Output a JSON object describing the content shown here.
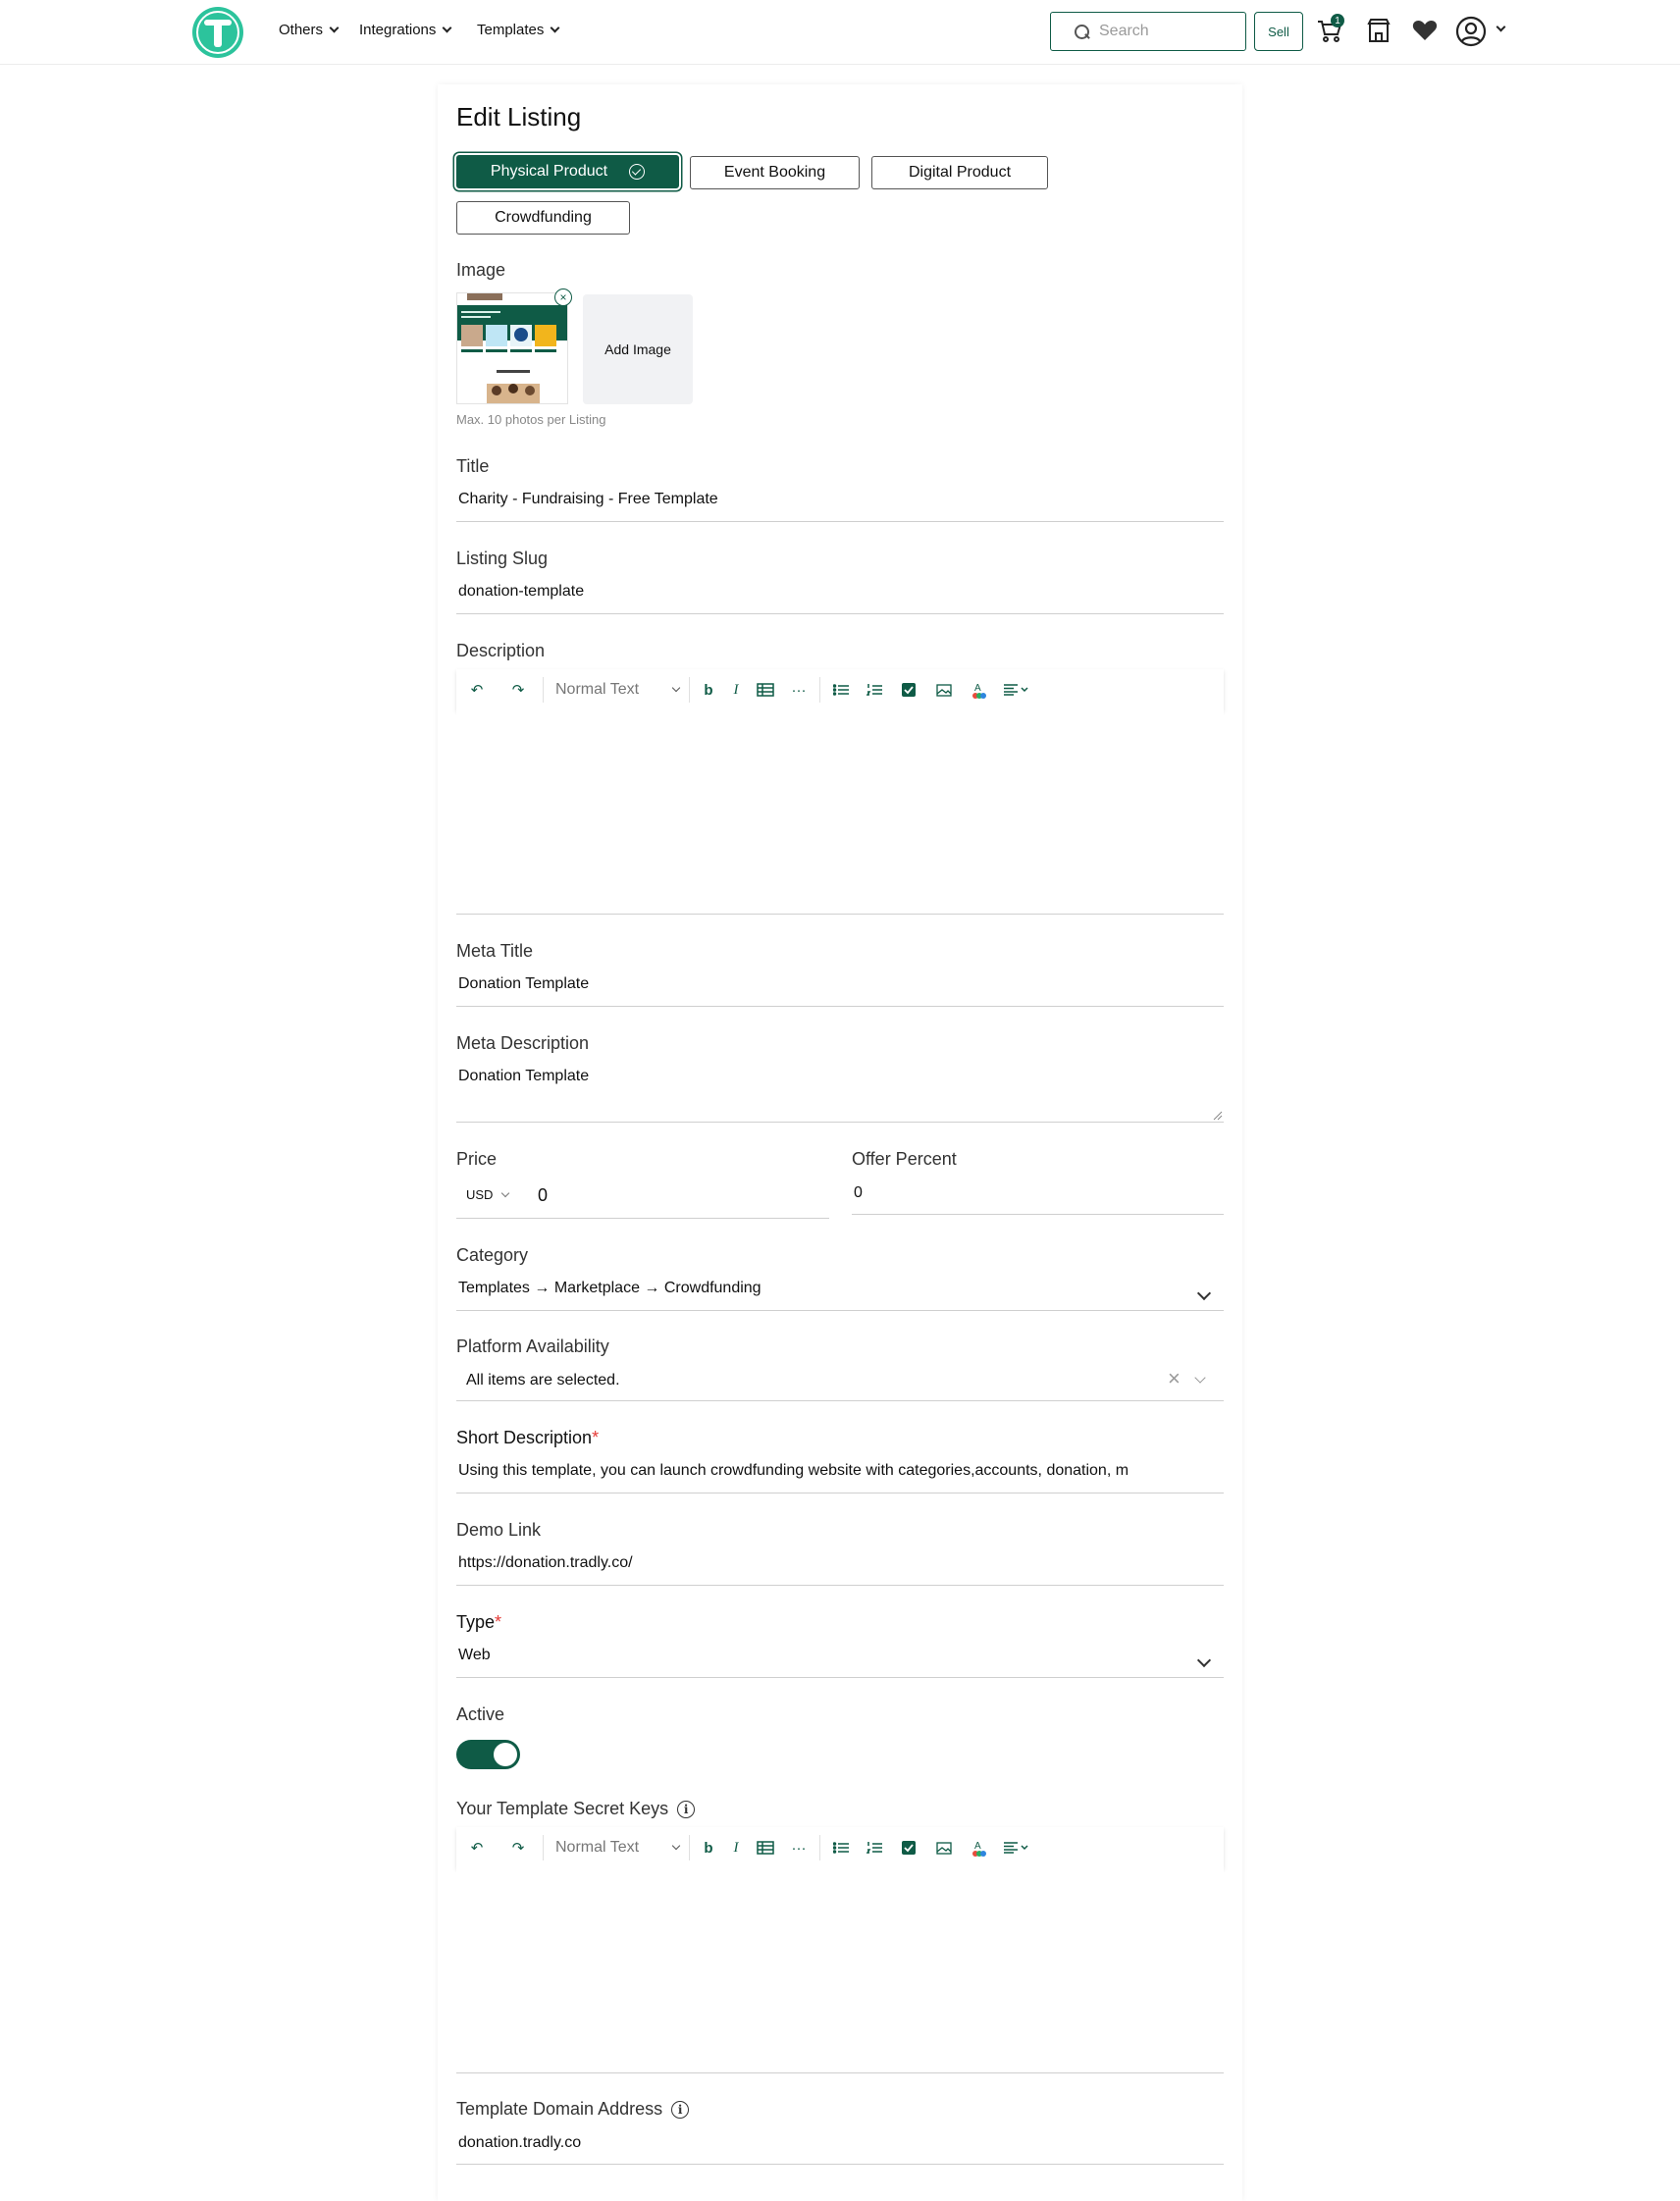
{
  "header": {
    "nav": [
      {
        "label": "Others"
      },
      {
        "label": "Integrations"
      },
      {
        "label": "Templates"
      }
    ],
    "search_placeholder": "Search",
    "sell_label": "Sell",
    "cart_count": "1",
    "icons": [
      "brand-logo-icon",
      "search-icon",
      "cart-icon",
      "store-icon",
      "heart-icon",
      "user-avatar-icon",
      "chevron-down-icon"
    ]
  },
  "page": {
    "title": "Edit Listing"
  },
  "listing_types": [
    {
      "label": "Physical Product",
      "selected": true
    },
    {
      "label": "Event Booking",
      "selected": false
    },
    {
      "label": "Digital Product",
      "selected": false
    },
    {
      "label": "Crowdfunding",
      "selected": false
    }
  ],
  "image": {
    "label": "Image",
    "add_label": "Add Image",
    "helper": "Max. 10 photos per Listing"
  },
  "fields": {
    "title": {
      "label": "Title",
      "value": "Charity - Fundraising - Free Template"
    },
    "slug": {
      "label": "Listing Slug",
      "value": "donation-template"
    },
    "description": {
      "label": "Description"
    },
    "meta_title": {
      "label": "Meta Title",
      "value": "Donation Template"
    },
    "meta_description": {
      "label": "Meta Description",
      "value": "Donation Template"
    },
    "price": {
      "label": "Price",
      "currency": "USD",
      "value": "0"
    },
    "offer_percent": {
      "label": "Offer Percent",
      "value": "0"
    },
    "category": {
      "label": "Category",
      "value": "Templates → Marketplace  → Crowdfunding"
    },
    "platform": {
      "label": "Platform Availability",
      "value": "All items are selected."
    },
    "short_description": {
      "label": "Short Description",
      "required_mark": "*",
      "value": "Using this template, you can launch crowdfunding website with categories,accounts, donation, m"
    },
    "demo_link": {
      "label": "Demo Link",
      "value": "https://donation.tradly.co/"
    },
    "type": {
      "label": "Type",
      "required_mark": "*",
      "value": "Web"
    },
    "active": {
      "label": "Active",
      "on": true
    },
    "secret_keys": {
      "label": "Your Template Secret Keys"
    },
    "domain": {
      "label": "Template Domain Address",
      "value": "donation.tradly.co"
    }
  },
  "editor_toolbar": {
    "block_style": "Normal Text",
    "undo": "↶",
    "redo": "↷",
    "bold": "b",
    "italic": "I",
    "more": "···",
    "icons": [
      "undo-icon",
      "redo-icon",
      "bold-icon",
      "italic-icon",
      "table-icon",
      "more-icon",
      "bullet-list-icon",
      "numbered-list-icon",
      "checkbox-icon",
      "image-icon",
      "text-color-icon",
      "align-icon"
    ]
  },
  "colors": {
    "brand": "#0f5b46",
    "logo": "#2cc39c",
    "required": "#e53935"
  }
}
